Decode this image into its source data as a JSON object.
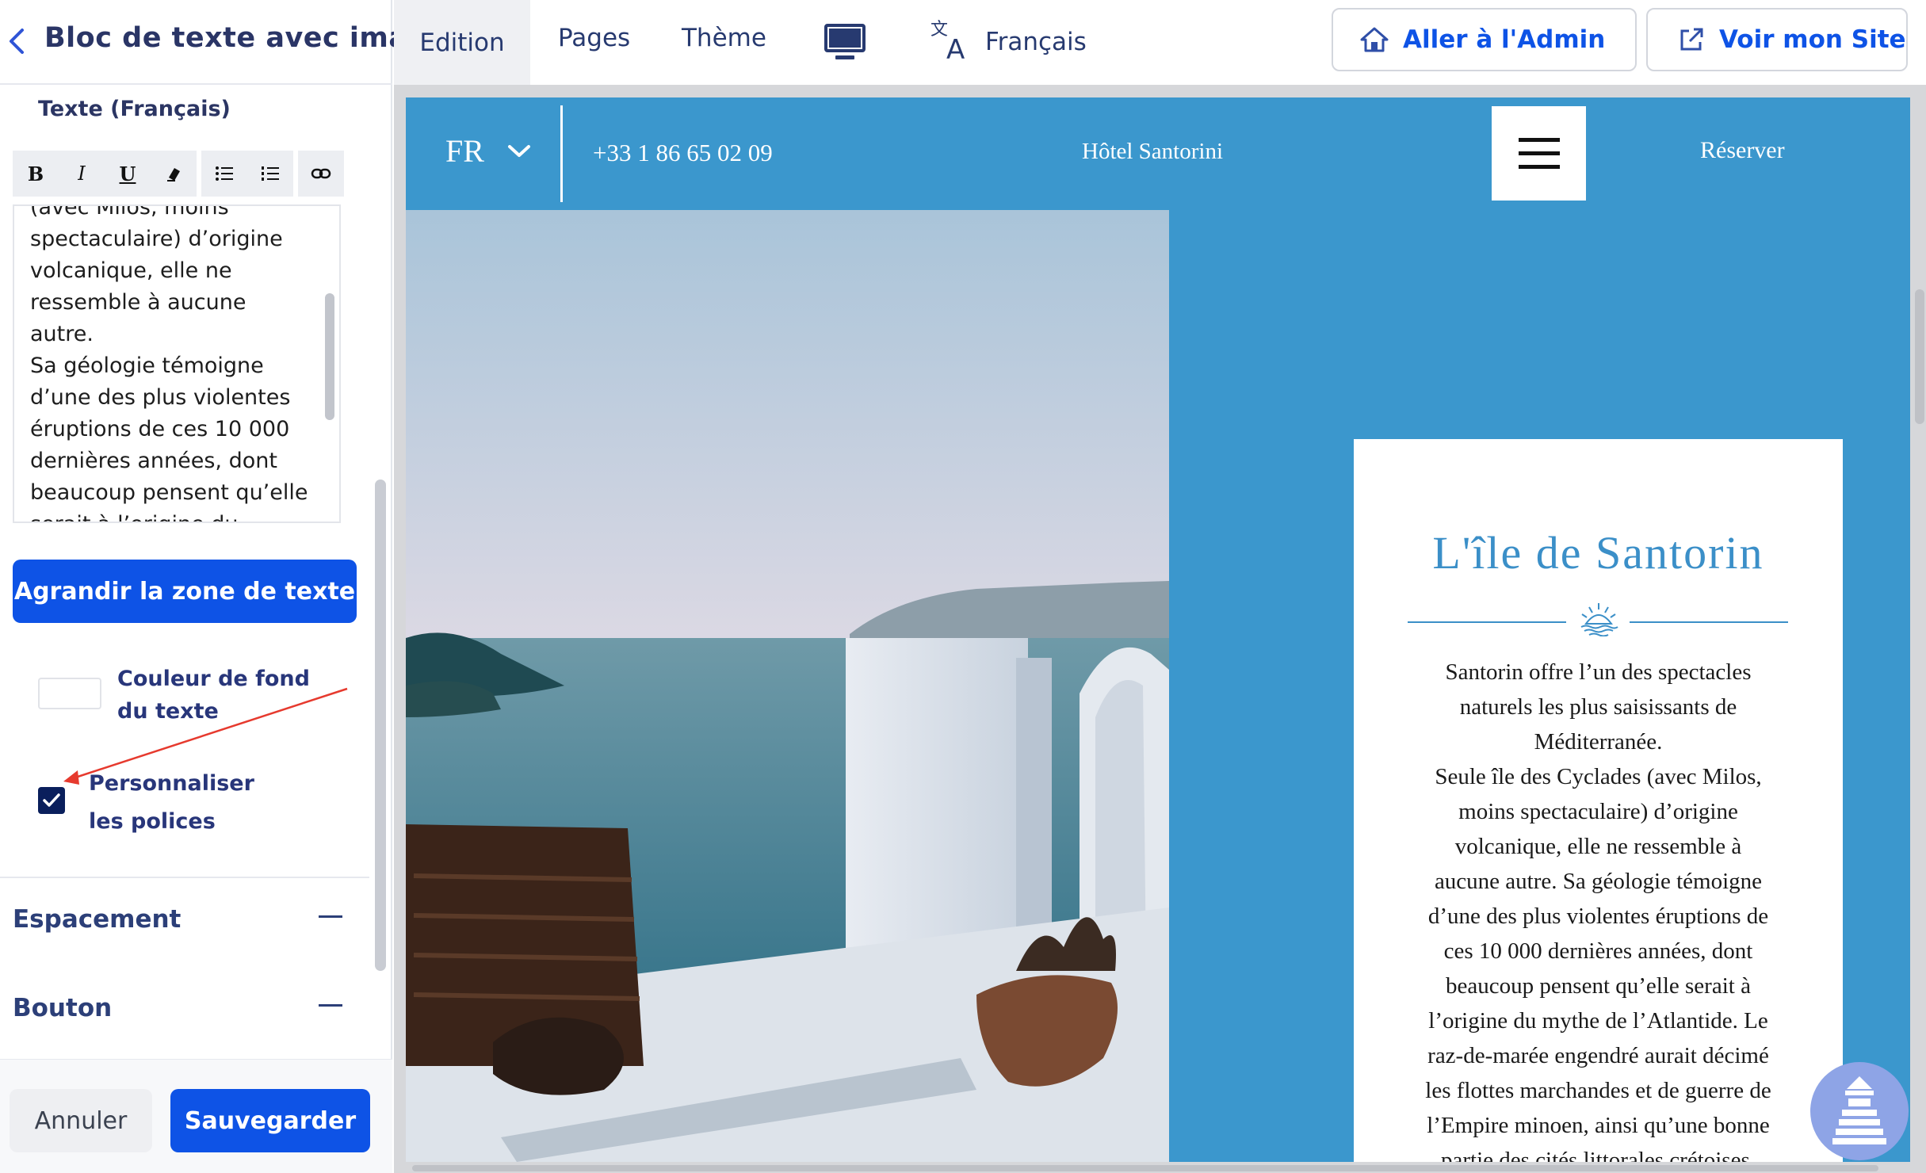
{
  "sidebar": {
    "title": "Bloc de texte avec image",
    "field_label": "Texte (Français)",
    "toolbar": {
      "bold": "B",
      "italic": "I",
      "underline": "U"
    },
    "editor_text": "(avec Milos, moins\nspectaculaire) d’origine\nvolcanique, elle ne\nressemble à aucune autre.\nSa géologie témoigne\nd’une des plus violentes\néruptions de ces 10 000\ndernières années, dont\nbeaucoup pensent qu’elle\nserait à l’origine du mythe\nde l’Atlantide. Le raz-de-",
    "enlarge_button": "Agrandir la zone de texte",
    "bg_color_label": "Couleur de fond du texte",
    "custom_fonts_label": "Personnaliser les polices",
    "custom_fonts_checked": true,
    "sections": [
      {
        "label": "Espacement"
      },
      {
        "label": "Bouton"
      }
    ],
    "cancel_button": "Annuler",
    "save_button": "Sauvegarder"
  },
  "topnav": {
    "tabs": [
      "Edition",
      "Pages",
      "Thème"
    ],
    "language": "Français",
    "admin_button": "Aller à l'Admin",
    "site_button": "Voir mon Site"
  },
  "site": {
    "lang": "FR",
    "phone": "+33 1 86 65 02 09",
    "name": "Hôtel Santorini",
    "reserve": "Réserver",
    "card_title": "L'île de Santorin",
    "card_body": "Santorin offre l’un des spectacles\nnaturels les plus saisissants de\nMéditerranée.\nSeule île des Cyclades (avec Milos,\nmoins spectaculaire) d’origine\nvolcanique, elle ne ressemble à\naucune autre. Sa géologie témoigne\nd’une des plus violentes éruptions de\nces 10 000 dernières années, dont\nbeaucoup pensent qu’elle serait à\nl’origine du mythe de l’Atlantide. Le\nraz-de-marée engendré aurait décimé\nles flottes marchandes et de guerre de\nl’Empire minoen, ainsi qu’une bonne\npartie des cités littorales crétoises."
  },
  "colors": {
    "primary": "#0e53e6",
    "site_blue": "#3b97cd",
    "title_blue": "#3b8fc8",
    "nav_text": "#273a70"
  }
}
